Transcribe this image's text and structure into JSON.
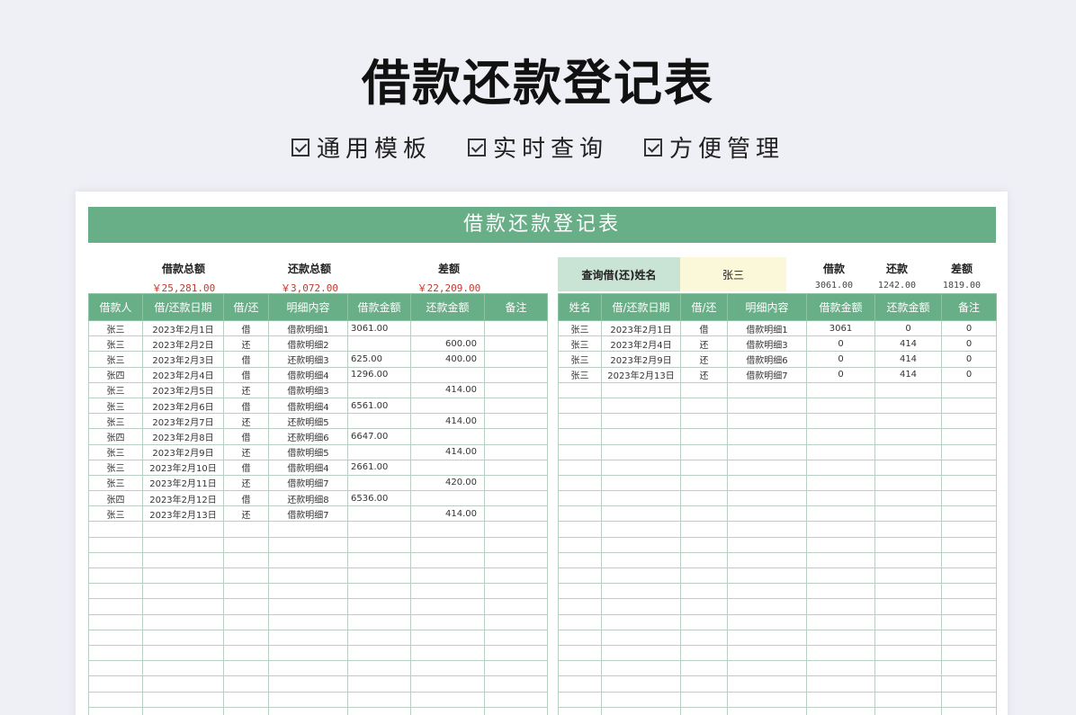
{
  "hero": {
    "title": "借款还款登记表",
    "features": [
      "通用模板",
      "实时查询",
      "方便管理"
    ]
  },
  "sheet": {
    "banner": "借款还款登记表",
    "summary": [
      {
        "label": "借款总额",
        "value": "￥25,281.00"
      },
      {
        "label": "还款总额",
        "value": "￥3,072.00"
      },
      {
        "label": "差额",
        "value": "￥22,209.00"
      }
    ],
    "query": {
      "label": "查询借(还)姓名",
      "value": "张三"
    },
    "right_summary": [
      {
        "label": "借款",
        "value": "3061.00"
      },
      {
        "label": "还款",
        "value": "1242.00"
      },
      {
        "label": "差额",
        "value": "1819.00"
      }
    ],
    "left_table": {
      "headers": [
        "借款人",
        "借/还款日期",
        "借/还",
        "明细内容",
        "借款金额",
        "还款金额",
        "备注"
      ],
      "rows": [
        [
          "张三",
          "2023年2月1日",
          "借",
          "借款明细1",
          "3061.00",
          "",
          ""
        ],
        [
          "张三",
          "2023年2月2日",
          "还",
          "借款明细2",
          "",
          "600.00",
          ""
        ],
        [
          "张三",
          "2023年2月3日",
          "借",
          "还款明细3",
          "625.00",
          "400.00",
          ""
        ],
        [
          "张四",
          "2023年2月4日",
          "借",
          "借款明细4",
          "1296.00",
          "",
          ""
        ],
        [
          "张三",
          "2023年2月5日",
          "还",
          "借款明细3",
          "",
          "414.00",
          ""
        ],
        [
          "张三",
          "2023年2月6日",
          "借",
          "借款明细4",
          "6561.00",
          "",
          ""
        ],
        [
          "张三",
          "2023年2月7日",
          "还",
          "还款明细5",
          "",
          "414.00",
          ""
        ],
        [
          "张四",
          "2023年2月8日",
          "借",
          "还款明细6",
          "6647.00",
          "",
          ""
        ],
        [
          "张三",
          "2023年2月9日",
          "还",
          "借款明细5",
          "",
          "414.00",
          ""
        ],
        [
          "张三",
          "2023年2月10日",
          "借",
          "借款明细4",
          "2661.00",
          "",
          ""
        ],
        [
          "张三",
          "2023年2月11日",
          "还",
          "借款明细7",
          "",
          "420.00",
          ""
        ],
        [
          "张四",
          "2023年2月12日",
          "借",
          "还款明细8",
          "6536.00",
          "",
          ""
        ],
        [
          "张三",
          "2023年2月13日",
          "还",
          "借款明细7",
          "",
          "414.00",
          ""
        ]
      ],
      "blank_rows": 13
    },
    "right_table": {
      "headers": [
        "姓名",
        "借/还款日期",
        "借/还",
        "明细内容",
        "借款金额",
        "还款金额",
        "备注"
      ],
      "rows": [
        [
          "张三",
          "2023年2月1日",
          "借",
          "借款明细1",
          "3061",
          "0",
          "0"
        ],
        [
          "张三",
          "2023年2月4日",
          "还",
          "借款明细3",
          "0",
          "414",
          "0"
        ],
        [
          "张三",
          "2023年2月9日",
          "还",
          "借款明细6",
          "0",
          "414",
          "0"
        ],
        [
          "张三",
          "2023年2月13日",
          "还",
          "借款明细7",
          "0",
          "414",
          "0"
        ]
      ],
      "blank_rows": 22
    }
  }
}
